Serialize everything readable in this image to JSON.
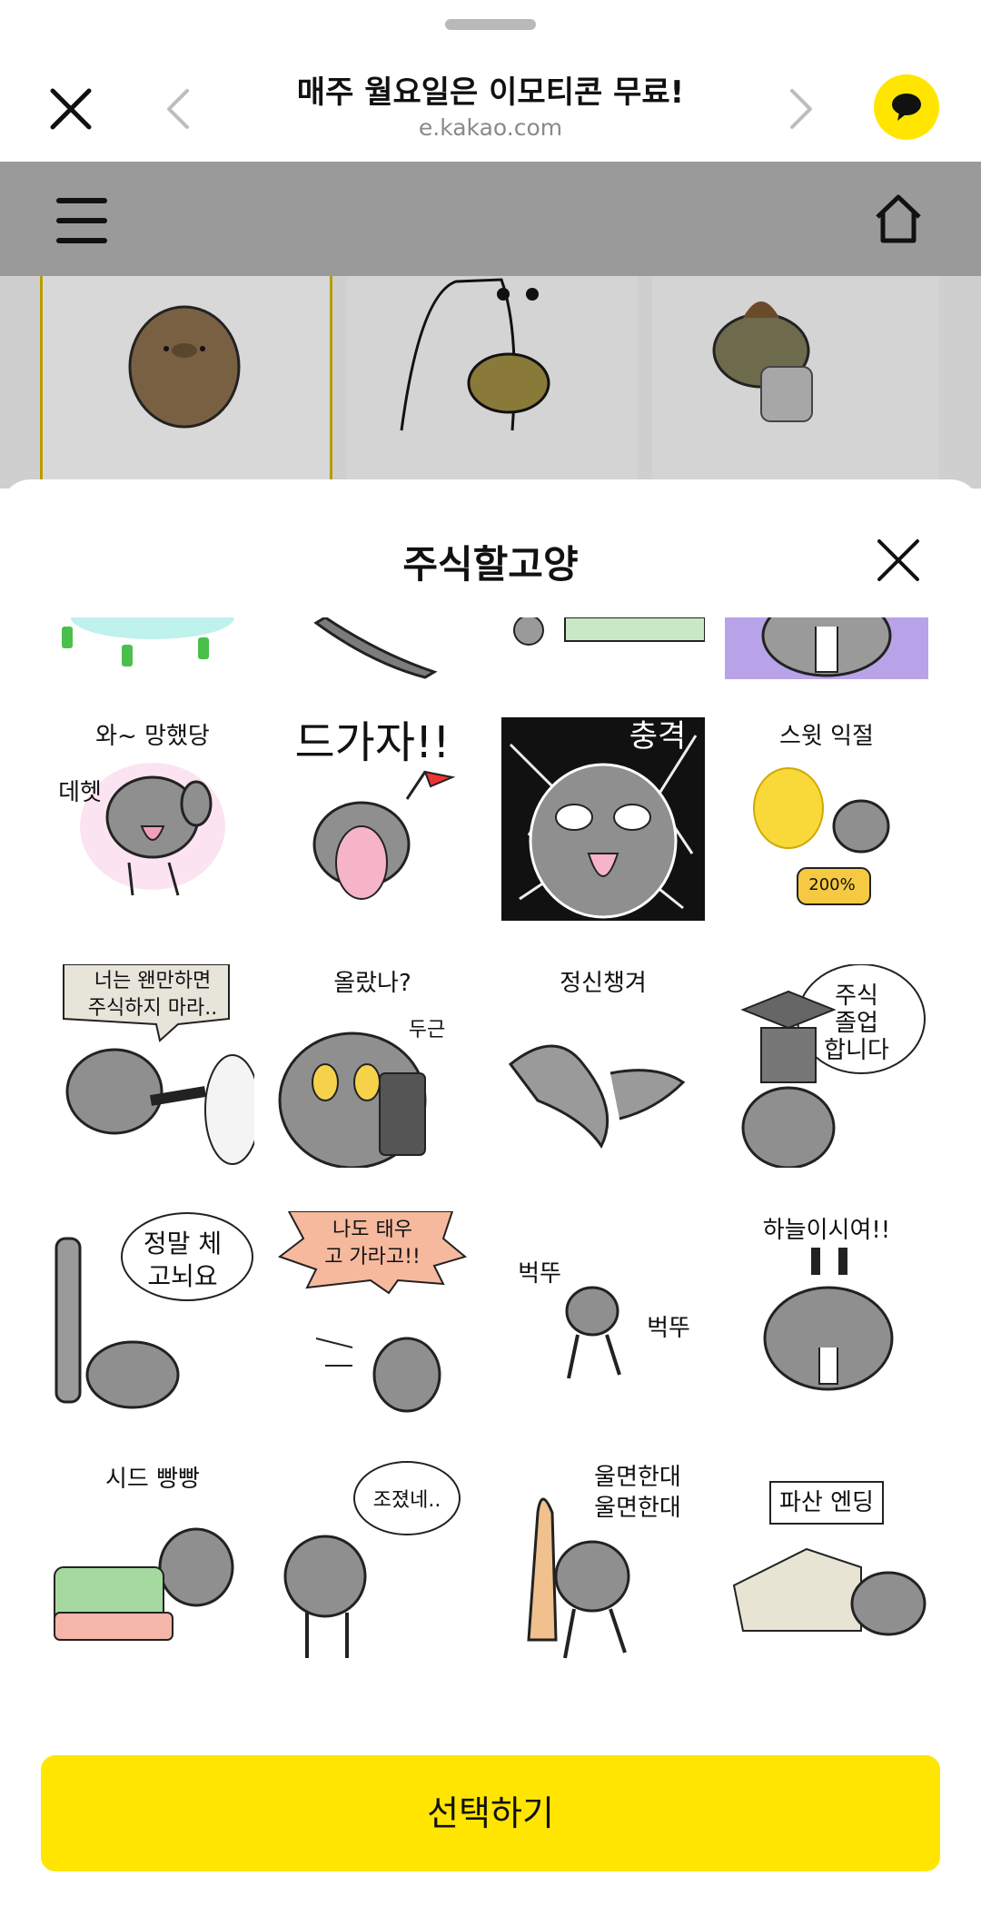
{
  "header": {
    "title": "매주 월요일은 이모티콘 무료!",
    "url": "e.kakao.com"
  },
  "sheet": {
    "title": "주식할고양",
    "select_label": "선택하기"
  },
  "stickers": [
    {
      "caption": "와~ 망했당",
      "extra": "데헷"
    },
    {
      "caption": "드가자!!",
      "extra": ""
    },
    {
      "caption": "충격",
      "extra": ""
    },
    {
      "caption": "스윗 익절",
      "extra": "200%"
    },
    {
      "caption": "너는 왠만하면\n주식하지 마라..",
      "extra": ""
    },
    {
      "caption": "올랐나?",
      "extra": "두근"
    },
    {
      "caption": "정신챙겨",
      "extra": ""
    },
    {
      "caption": "주식\n졸업\n합니다",
      "extra": ""
    },
    {
      "caption": "정말 체\n고뇌요",
      "extra": ""
    },
    {
      "caption": "나도 태우\n고 가라고!!",
      "extra": ""
    },
    {
      "caption": "벅뚜",
      "extra": "벅뚜"
    },
    {
      "caption": "하늘이시여!!",
      "extra": ""
    },
    {
      "caption": "시드 빵빵",
      "extra": ""
    },
    {
      "caption": "조졌네..",
      "extra": ""
    },
    {
      "caption": "울면한대\n울면한대",
      "extra": ""
    },
    {
      "caption": "파산 엔딩",
      "extra": ""
    }
  ],
  "icons": {
    "close": "close-icon",
    "back": "chevron-left-icon",
    "forward": "chevron-right-icon",
    "talk": "chat-bubble-icon",
    "menu": "hamburger-icon",
    "home": "home-icon"
  },
  "colors": {
    "accent": "#FFE500",
    "dim": "#9A9A9A"
  }
}
